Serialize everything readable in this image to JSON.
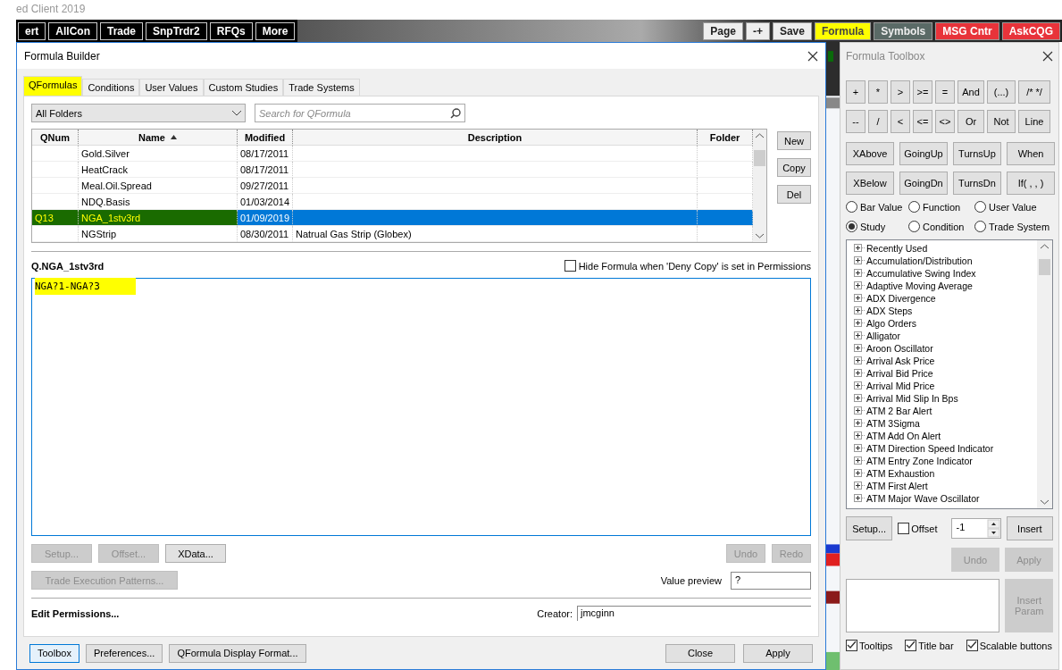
{
  "app_title": "ed Client 2019",
  "toolbar": [
    {
      "label": "ert",
      "kind": "dark",
      "highlighted": false
    },
    {
      "label": "AllCon",
      "kind": "dark",
      "highlighted": false
    },
    {
      "label": "Trade",
      "kind": "dark",
      "highlighted": false
    },
    {
      "label": "SnpTrdr2",
      "kind": "dark",
      "highlighted": false
    },
    {
      "label": "RFQs",
      "kind": "dark",
      "highlighted": false
    },
    {
      "label": "More",
      "kind": "dark",
      "highlighted": false
    },
    {
      "label": "Page",
      "kind": "light",
      "highlighted": false
    },
    {
      "label": "-+",
      "kind": "light",
      "highlighted": false
    },
    {
      "label": "Save",
      "kind": "light",
      "highlighted": false
    },
    {
      "label": "Formula",
      "kind": "green",
      "highlighted": true
    },
    {
      "label": "Symbols",
      "kind": "green",
      "highlighted": false
    },
    {
      "label": "MSG Cntr",
      "kind": "red",
      "highlighted": false
    },
    {
      "label": "AskCQG",
      "kind": "red",
      "highlighted": false
    }
  ],
  "formula_builder": {
    "title": "Formula Builder",
    "tabs": [
      {
        "label": "QFormulas",
        "selected": true,
        "highlighted": true
      },
      {
        "label": "Conditions",
        "selected": false,
        "highlighted": false
      },
      {
        "label": "User Values",
        "selected": false,
        "highlighted": false
      },
      {
        "label": "Custom Studies",
        "selected": false,
        "highlighted": false
      },
      {
        "label": "Trade Systems",
        "selected": false,
        "highlighted": false
      }
    ],
    "folder": "All Folders",
    "search": {
      "placeholder": "Search for QFormula"
    },
    "table": {
      "columns": [
        "QNum",
        "Name",
        "Modified",
        "Description",
        "Folder"
      ],
      "rows": [
        {
          "qnum": "",
          "name": "Gold.Silver",
          "modified": "08/17/2011",
          "description": "",
          "selected": false,
          "highlighted": false
        },
        {
          "qnum": "",
          "name": "HeatCrack",
          "modified": "08/17/2011",
          "description": "",
          "selected": false,
          "highlighted": false
        },
        {
          "qnum": "",
          "name": "Meal.Oil.Spread",
          "modified": "09/27/2011",
          "description": "",
          "selected": false,
          "highlighted": false
        },
        {
          "qnum": "",
          "name": "NDQ.Basis",
          "modified": "01/03/2014",
          "description": "",
          "selected": false,
          "highlighted": false
        },
        {
          "qnum": "Q13",
          "name": "NGA_1stv3rd",
          "modified": "01/09/2019",
          "description": "",
          "selected": true,
          "highlighted": true
        },
        {
          "qnum": "",
          "name": "NGStrip",
          "modified": "08/30/2011",
          "description": "Natrual Gas Strip (Globex)",
          "selected": false,
          "highlighted": false
        }
      ]
    },
    "side_buttons": [
      "New",
      "Copy",
      "Del"
    ],
    "formula_name": "Q.NGA_1stv3rd",
    "hide_formula": {
      "label": "Hide Formula when 'Deny Copy' is set in Permissions",
      "checked": false
    },
    "formula": {
      "text": "NGA?1-NGA?3",
      "highlighted": true
    },
    "left_buttons": [
      {
        "label": "Setup...",
        "disabled": true
      },
      {
        "label": "Offset...",
        "disabled": true
      },
      {
        "label": "XData...",
        "disabled": false
      }
    ],
    "right_buttons": [
      {
        "label": "Undo",
        "disabled": true
      },
      {
        "label": "Redo",
        "disabled": true
      }
    ],
    "trade_button": {
      "label": "Trade Execution Patterns...",
      "disabled": true
    },
    "value_preview": {
      "label": "Value preview",
      "value": "?"
    },
    "edit_permissions": "Edit Permissions...",
    "creator": {
      "label": "Creator:",
      "value": "jmcginn"
    },
    "footer_left": [
      {
        "label": "Toolbox",
        "focused": true
      },
      {
        "label": "Preferences...",
        "focused": false
      },
      {
        "label": "QFormula Display Format...",
        "focused": false
      }
    ],
    "footer_right": [
      "Close",
      "Apply"
    ]
  },
  "toolbox": {
    "title": "Formula Toolbox",
    "operators": [
      "+",
      "*",
      ">",
      ">=",
      "=",
      "And",
      "(...)",
      "/* */",
      "--",
      "/",
      "<",
      "<=",
      "<>",
      "Or",
      "Not",
      "Line"
    ],
    "functions": [
      "XAbove",
      "GoingUp",
      "TurnsUp",
      "When",
      "XBelow",
      "GoingDn",
      "TurnsDn",
      "If( , , )"
    ],
    "categories": [
      {
        "label": "Bar Value",
        "selected": false
      },
      {
        "label": "Function",
        "selected": false
      },
      {
        "label": "User Value",
        "selected": false
      },
      {
        "label": "Study",
        "selected": true
      },
      {
        "label": "Condition",
        "selected": false
      },
      {
        "label": "Trade System",
        "selected": false
      }
    ],
    "tree": [
      "Recently Used",
      "Accumulation/Distribution",
      "Accumulative Swing Index",
      "Adaptive Moving Average",
      "ADX Divergence",
      "ADX Steps",
      "Algo Orders",
      "Alligator",
      "Aroon Oscillator",
      "Arrival Ask Price",
      "Arrival Bid Price",
      "Arrival Mid Price",
      "Arrival Mid Slip In Bps",
      "ATM 2 Bar Alert",
      "ATM 3Sigma",
      "ATM Add On Alert",
      "ATM Direction Speed Indicator",
      "ATM Entry Zone Indicator",
      "ATM Exhaustion",
      "ATM First Alert",
      "ATM Major Wave Oscillator"
    ],
    "setup_button": "Setup...",
    "offset": {
      "label": "Offset",
      "checked": false
    },
    "offset_value": "-1",
    "insert_button": "Insert",
    "edit_buttons": [
      {
        "label": "Undo",
        "disabled": true
      },
      {
        "label": "Apply",
        "disabled": true
      }
    ],
    "insert_param": {
      "label": "Insert Param",
      "disabled": true
    },
    "options": [
      {
        "label": "Tooltips",
        "checked": true
      },
      {
        "label": "Title bar",
        "checked": true
      },
      {
        "label": "Scalable buttons",
        "checked": true
      }
    ]
  }
}
